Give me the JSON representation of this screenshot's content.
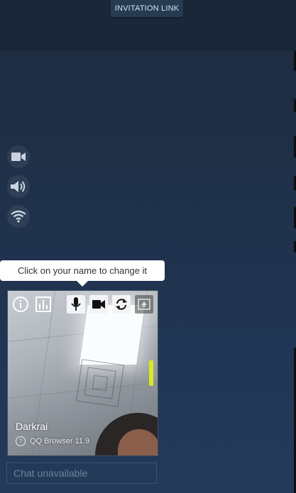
{
  "header": {
    "invite_label": "INVITATION LINK"
  },
  "side_controls": [
    {
      "name": "camera-toggle",
      "icon": "video-camera-icon"
    },
    {
      "name": "speaker-toggle",
      "icon": "speaker-icon"
    },
    {
      "name": "network-status",
      "icon": "wifi-icon"
    }
  ],
  "tooltip": {
    "text": "Click on your name to change it"
  },
  "participant": {
    "name": "Darkrai",
    "browser": "QQ Browser 11.9",
    "browser_icon": "?",
    "audio_level_color": "#d9ea1c",
    "toolbar": [
      "info-icon",
      "stats-icon",
      "microphone-icon",
      "video-camera-icon",
      "refresh-icon",
      "screen-share-icon"
    ]
  },
  "chat": {
    "placeholder": "Chat unavailable"
  }
}
